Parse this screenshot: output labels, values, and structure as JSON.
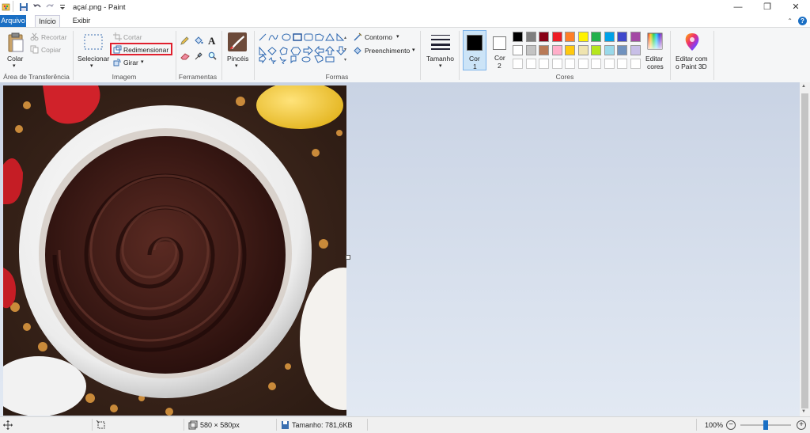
{
  "window": {
    "title": "açaí.png - Paint",
    "minimize": "—",
    "restore": "❐",
    "close": "✕"
  },
  "tabs": {
    "arquivo": "Arquivo",
    "inicio": "Início",
    "exibir": "Exibir",
    "help": "?"
  },
  "clipboard": {
    "paste": "Colar",
    "cut": "Recortar",
    "copy": "Copiar",
    "group": "Área de Transferência"
  },
  "image": {
    "select": "Selecionar",
    "crop": "Cortar",
    "resize": "Redimensionar",
    "rotate": "Girar",
    "group": "Imagem"
  },
  "tools": {
    "group": "Ferramentas"
  },
  "brushes": {
    "label": "Pincéis"
  },
  "shapes": {
    "outline": "Contorno",
    "fill": "Preenchimento",
    "group": "Formas"
  },
  "size": {
    "label": "Tamanho"
  },
  "colors": {
    "color1_line1": "Cor",
    "color1_line2": "1",
    "color2_line1": "Cor",
    "color2_line2": "2",
    "edit_line1": "Editar",
    "edit_line2": "cores",
    "group": "Cores",
    "color1_value": "#000000",
    "color2_value": "#ffffff",
    "palette_row1": [
      "#000000",
      "#7f7f7f",
      "#880015",
      "#ed1c24",
      "#ff7f27",
      "#fff200",
      "#22b14c",
      "#00a2e8",
      "#3f48cc",
      "#a349a4"
    ],
    "palette_row2": [
      "#ffffff",
      "#c3c3c3",
      "#b97a57",
      "#ffaec9",
      "#ffc90e",
      "#efe4b0",
      "#b5e61d",
      "#99d9ea",
      "#7092be",
      "#c8bfe7"
    ]
  },
  "paint3d": {
    "line1": "Editar com",
    "line2": "o Paint 3D"
  },
  "status": {
    "dimensions": "580 × 580px",
    "size": "Tamanho: 781,6KB",
    "zoom": "100%",
    "zoom_level": 1.0
  },
  "accent": "#1a6fc4",
  "highlight": "#e0202e"
}
